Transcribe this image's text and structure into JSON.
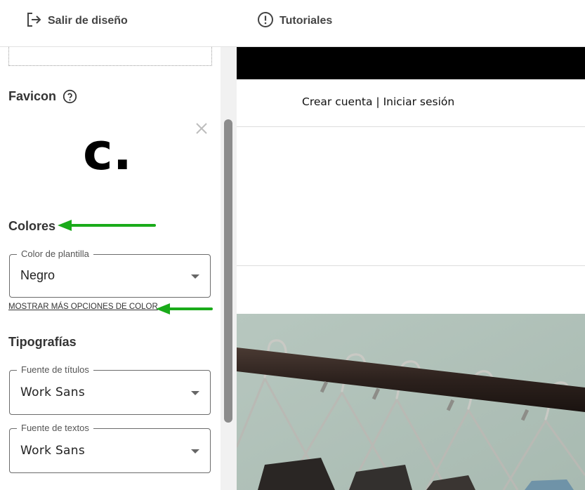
{
  "topbar": {
    "exit_label": "Salir de diseño",
    "exit_icon": "exit-icon",
    "tutorials_label": "Tutoriales",
    "tutorials_icon": "alert-circle-icon"
  },
  "sidebar": {
    "favicon": {
      "title": "Favicon",
      "logo_text": "c."
    },
    "colors": {
      "title": "Colores",
      "template_color_legend": "Color de plantilla",
      "template_color_value": "Negro",
      "more_options_link": "MOSTRAR MÁS OPCIONES DE COLOR"
    },
    "typography": {
      "title": "Tipografías",
      "titles_font_legend": "Fuente de títulos",
      "titles_font_value": "Work Sans",
      "texts_font_legend": "Fuente de textos",
      "texts_font_value": "Work Sans"
    }
  },
  "preview": {
    "create_account": "Crear cuenta",
    "separator": " | ",
    "login": "Iniciar sesión"
  },
  "colors": {
    "annotation_arrow": "#1aab1a",
    "preview_header": "#000000"
  }
}
